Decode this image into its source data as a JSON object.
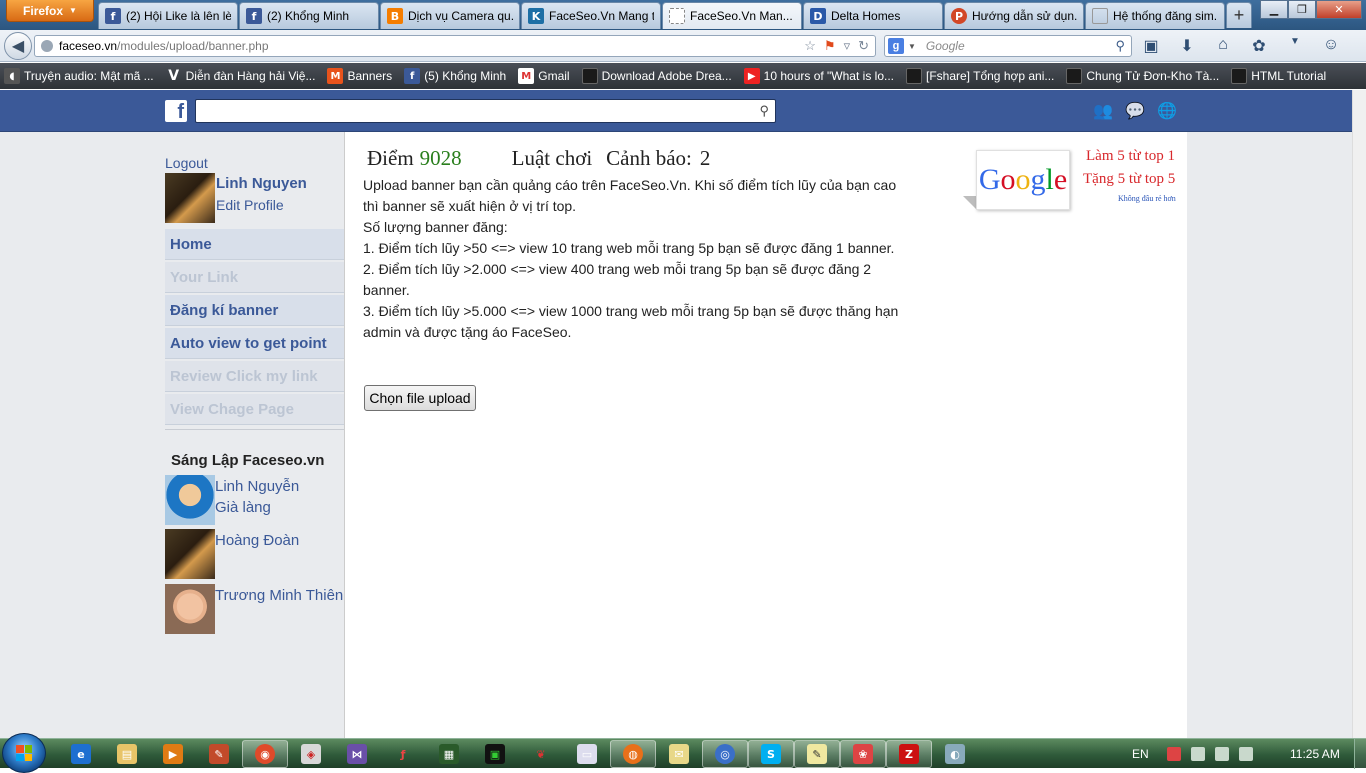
{
  "browser": {
    "menu_button": "Firefox",
    "tabs": [
      {
        "label": "(2) Hội Like là lên lè...",
        "icon": "facebook-icon"
      },
      {
        "label": "(2) Khổng Minh",
        "icon": "facebook-icon"
      },
      {
        "label": "Dịch vụ Camera qu...",
        "icon": "blogger-icon"
      },
      {
        "label": "FaceSeo.Vn Mang t...",
        "icon": "faceseo-icon"
      },
      {
        "label": "FaceSeo.Vn Man...",
        "icon": "loading-icon"
      },
      {
        "label": "Delta Homes",
        "icon": "delta-icon"
      },
      {
        "label": "Hướng dẫn sử dụn...",
        "icon": "p-icon"
      },
      {
        "label": "Hệ thống đăng sim...",
        "icon": "blank-icon"
      }
    ],
    "url_host": "faceseo.vn",
    "url_path": "/modules/upload/banner.php",
    "search_placeholder": "Google",
    "bookmarks": [
      {
        "label": "Truyện audio: Mật mã ...",
        "icon": "headset-icon"
      },
      {
        "label": "Diễn đàn Hàng hải Việ...",
        "icon": "vinamarine-icon"
      },
      {
        "label": "Banners",
        "icon": "magento-icon"
      },
      {
        "label": "(5) Khổng Minh",
        "icon": "facebook-icon"
      },
      {
        "label": "Gmail",
        "icon": "gmail-icon"
      },
      {
        "label": "Download Adobe Drea...",
        "icon": "folder-icon"
      },
      {
        "label": "10 hours of \"What is lo...",
        "icon": "youtube-icon"
      },
      {
        "label": "[Fshare] Tổng hợp ani...",
        "icon": "folder-icon"
      },
      {
        "label": "Chung Tử Đơn-Kho Tà...",
        "icon": "folder-icon"
      },
      {
        "label": "HTML Tutorial",
        "icon": "folder-icon"
      }
    ]
  },
  "sidebar": {
    "logout": "Logout",
    "profile_name": "Linh Nguyen",
    "edit_profile": "Edit Profile",
    "menu": [
      {
        "label": "Home",
        "enabled": true
      },
      {
        "label": "Your Link",
        "enabled": false
      },
      {
        "label": "Đăng kí banner",
        "enabled": true
      },
      {
        "label": "Auto view to get point",
        "enabled": true
      },
      {
        "label": "Review Click my link",
        "enabled": false
      },
      {
        "label": "View Chage Page",
        "enabled": false
      }
    ],
    "founders_title": "Sáng Lập Faceseo.vn",
    "founders": [
      {
        "name": "Linh Nguyễn",
        "role": "Già làng"
      },
      {
        "name": "Hoàng Đoàn",
        "role": ""
      },
      {
        "name": "Trương Minh Thiên",
        "role": ""
      }
    ]
  },
  "main": {
    "score_label": "Điểm",
    "score_value": "9028",
    "rules_label": "Luật chơi",
    "warning_label": "Cảnh báo:",
    "warning_value": "2",
    "description": [
      "Upload banner bạn cần quảng cáo trên FaceSeo.Vn. Khi số điểm tích lũy của bạn cao thì banner sẽ xuất hiện ở vị trí top.",
      "Số lượng banner đăng:",
      "1. Điểm tích lũy >50 <=> view 10 trang web mỗi trang 5p bạn sẽ được đăng 1 banner.",
      "2. Điểm tích lũy >2.000 <=> view 400 trang web mỗi trang 5p bạn sẽ được đăng 2 banner.",
      "3. Điểm tích lũy >5.000 <=> view 1000 trang web mỗi trang 5p bạn sẽ được thăng hạn admin và được tặng áo FaceSeo."
    ],
    "upload_button": "Chọn file upload",
    "ad": {
      "logo_text": "Google",
      "line1": "Làm 5 từ top 1",
      "line2": "Tặng 5 từ top 5",
      "line3": "Không đâu rẻ hơn"
    }
  },
  "taskbar": {
    "language": "EN",
    "clock": "11:25 AM"
  },
  "colors": {
    "facebook_blue": "#3b5998",
    "score_green": "#2a7f1d",
    "ad_red": "#d8282c"
  }
}
